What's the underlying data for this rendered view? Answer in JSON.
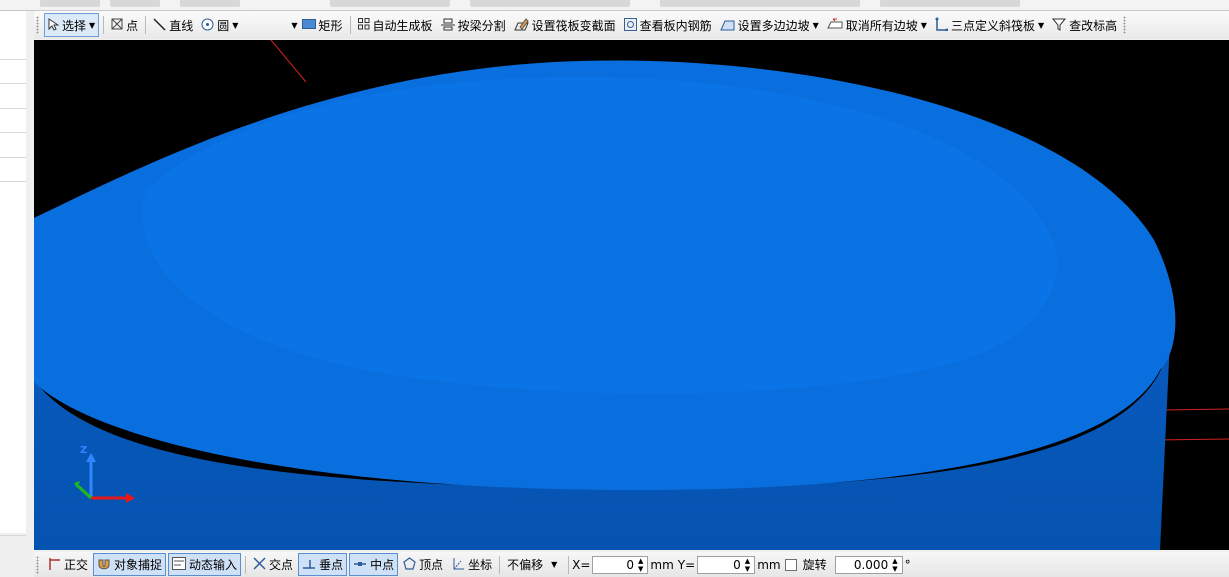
{
  "toolbar": {
    "items": [
      {
        "name": "select-tool",
        "icon": "cursor-icon",
        "label": "选择",
        "dropdown": true,
        "pressed": true
      },
      {
        "name": "point-tool",
        "icon": "point-icon",
        "label": "点",
        "dropdown": false
      },
      {
        "name": "line-tool",
        "icon": "line-icon",
        "label": "直线",
        "dropdown": false
      },
      {
        "name": "circle-tool",
        "icon": "circle-icon",
        "label": "圆",
        "dropdown": true
      },
      {
        "name": "rectangle-tool",
        "icon": "rectangle-icon",
        "label": "矩形",
        "dropdown": false
      },
      {
        "name": "auto-generate-slab",
        "icon": "grid-icon",
        "label": "自动生成板",
        "dropdown": false
      },
      {
        "name": "split-by-beam",
        "icon": "split-icon",
        "label": "按梁分割",
        "dropdown": false
      },
      {
        "name": "set-raft-section",
        "icon": "edit-section-icon",
        "label": "设置筏板变截面",
        "dropdown": false
      },
      {
        "name": "view-slab-rebar",
        "icon": "rebar-icon",
        "label": "查看板内钢筋",
        "dropdown": false
      },
      {
        "name": "set-multi-slope",
        "icon": "slope-icon",
        "label": "设置多边边坡",
        "dropdown": true
      },
      {
        "name": "cancel-all-slopes",
        "icon": "cancel-slope-icon",
        "label": "取消所有边坡",
        "dropdown": true
      },
      {
        "name": "three-point-inclined-raft",
        "icon": "three-point-icon",
        "label": "三点定义斜筏板",
        "dropdown": true
      },
      {
        "name": "modify-elevation",
        "icon": "elevation-icon",
        "label": "查改标高",
        "dropdown": false
      }
    ]
  },
  "viewport": {
    "background_color": "#000000",
    "slab_top_color": "#0a6fde",
    "slab_side_color": "#0556b5",
    "axes": {
      "z_label": "Z",
      "z_color": "#2f86ff",
      "x_color": "#e81818",
      "y_color": "#1dbb1d"
    }
  },
  "statusbar": {
    "ortho_label": "正交",
    "object_snap_label": "对象捕捉",
    "dynamic_input_label": "动态输入",
    "intersection_label": "交点",
    "perpendicular_label": "垂点",
    "midpoint_label": "中点",
    "vertex_label": "顶点",
    "coordinate_label": "坐标",
    "offset_mode": "不偏移",
    "x_label": "X=",
    "x_value": "0",
    "x_unit": "mm",
    "y_label": "Y=",
    "y_value": "0",
    "y_unit": "mm",
    "rotate_label": "旋转",
    "rotate_value": "0.000",
    "degree_symbol": "°"
  }
}
